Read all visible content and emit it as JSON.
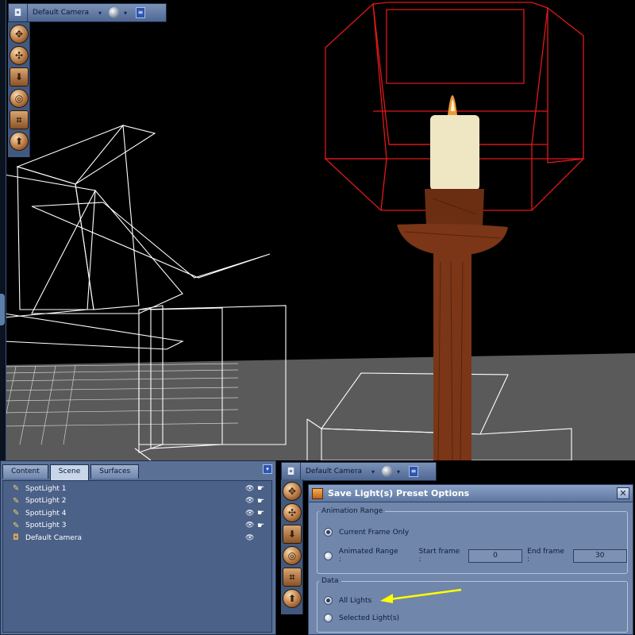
{
  "viewport": {
    "camera_label": "Default Camera"
  },
  "panel_tabs": [
    {
      "label": "Content"
    },
    {
      "label": "Scene"
    },
    {
      "label": "Surfaces"
    }
  ],
  "scene_items": [
    {
      "label": "SpotLight 1",
      "icon": "spotlight-icon"
    },
    {
      "label": "SpotLight 2",
      "icon": "spotlight-icon"
    },
    {
      "label": "SpotLight 4",
      "icon": "spotlight-icon"
    },
    {
      "label": "SpotLight 3",
      "icon": "spotlight-icon"
    },
    {
      "label": "Default Camera",
      "icon": "camera-icon"
    }
  ],
  "mini_viewport": {
    "camera_label": "Default Camera"
  },
  "dialog": {
    "title": "Save Light(s) Preset Options",
    "animation_range": {
      "legend": "Animation Range",
      "current_frame_label": "Current Frame Only",
      "animated_range_label": "Animated Range :",
      "start_frame_label": "Start frame :",
      "start_frame_value": "0",
      "end_frame_label": "End frame :",
      "end_frame_value": "30",
      "selected": "current_frame"
    },
    "data": {
      "legend": "Data",
      "all_lights_label": "All Lights",
      "selected_lights_label": "Selected Light(s)",
      "selected": "all_lights"
    }
  },
  "colors": {
    "panel_blue": "#5a7095",
    "dialog_bg": "#7186ab",
    "wire_red": "#e01818",
    "wire_white": "#ffffff",
    "annotation_arrow": "#ffff00"
  }
}
